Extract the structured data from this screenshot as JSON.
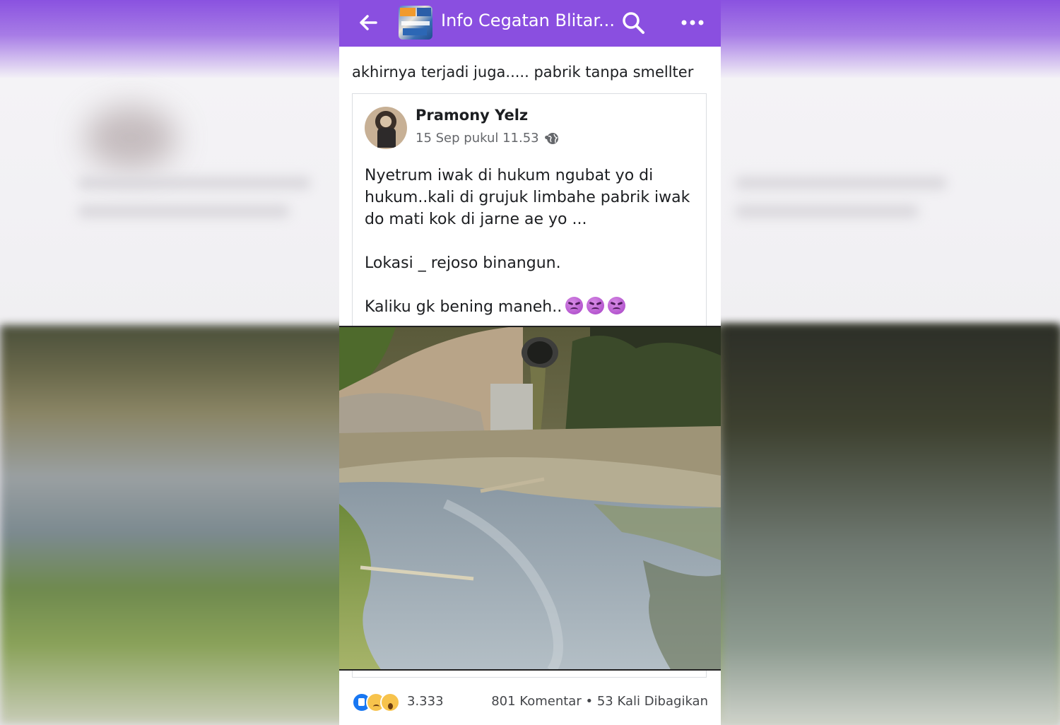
{
  "header": {
    "title": "Info Cegatan Blitar...",
    "icons": {
      "back": "arrow-left-icon",
      "search": "search-icon",
      "more": "more-horizontal-icon"
    }
  },
  "post": {
    "caption": "akhirnya terjadi juga..... pabrik tanpa smellter",
    "shared": {
      "author": "Pramony Yelz",
      "timestamp": "15 Sep pukul 11.53",
      "separator": "•",
      "audience_icon": "globe-icon",
      "paragraphs": [
        "Nyetrum iwak di hukum ngubat yo di hukum..kali di grujuk limbahe pabrik iwak do mati kok di jarne ae yo ...",
        "Lokasi _ rejoso binangun.",
        "Kaliku gk bening maneh.."
      ],
      "emoji_count": 3
    }
  },
  "footer": {
    "reaction_count": "3.333",
    "comments": "801 Komentar",
    "shares": "53 Kali Dibagikan",
    "dot": "•"
  },
  "colors": {
    "header_bg": "#8a4fe0",
    "like_blue": "#1877f2"
  }
}
